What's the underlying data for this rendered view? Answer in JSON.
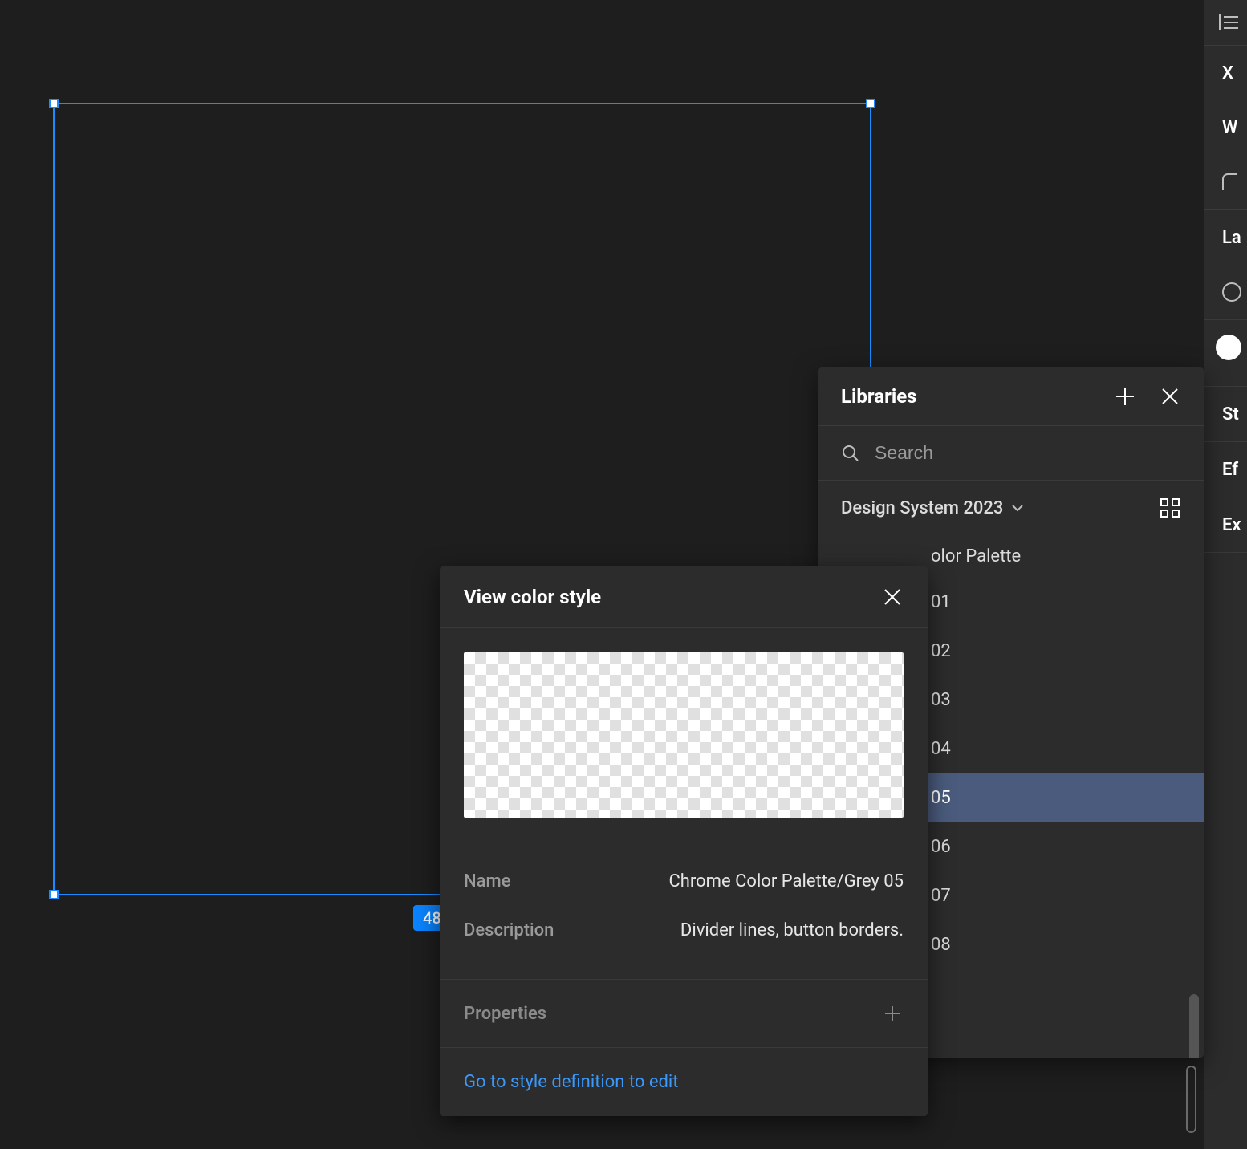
{
  "canvas": {
    "selection_size_label": "48"
  },
  "right_column": {
    "items": [
      "X",
      "W",
      "La",
      "St",
      "Ef",
      "Ex"
    ]
  },
  "libraries": {
    "title": "Libraries",
    "search_placeholder": "Search",
    "library_name": "Design System 2023",
    "group_title": "olor Palette",
    "items": [
      "01",
      "02",
      "03",
      "04",
      "05",
      "06",
      "07",
      "08"
    ],
    "selected_index": 4
  },
  "color_style": {
    "title": "View color style",
    "name_label": "Name",
    "name_value": "Chrome Color Palette/Grey 05",
    "description_label": "Description",
    "description_value": "Divider lines, button borders.",
    "properties_label": "Properties",
    "link_text": "Go to style definition to edit"
  }
}
